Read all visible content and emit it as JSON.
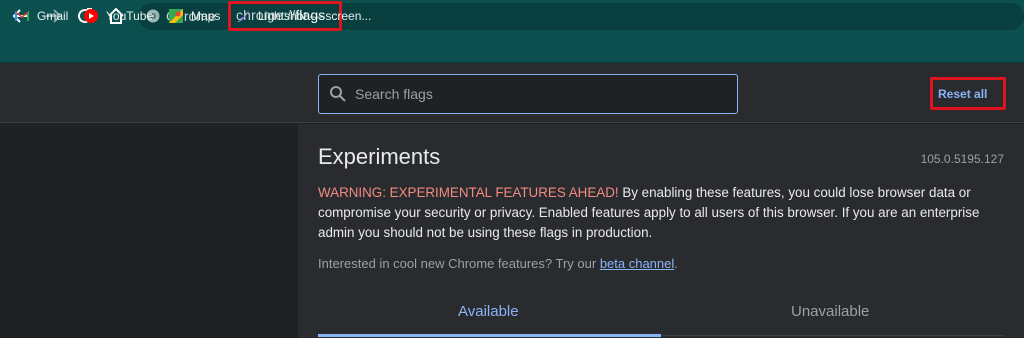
{
  "browser": {
    "site_chip_label": "Chrome",
    "url_scheme": "chrome://",
    "url_path": "flags",
    "highlight_color": "#e0141e"
  },
  "bookmarks": [
    {
      "label": "Gmail",
      "icon": "gmail-icon"
    },
    {
      "label": "YouTube",
      "icon": "youtube-icon"
    },
    {
      "label": "Maps",
      "icon": "maps-icon"
    },
    {
      "label": "Lightshot — screen...",
      "icon": "lightshot-icon"
    }
  ],
  "header": {
    "search_placeholder": "Search flags",
    "reset_label": "Reset all"
  },
  "main": {
    "title": "Experiments",
    "version": "105.0.5195.127",
    "warning_head": "WARNING: EXPERIMENTAL FEATURES AHEAD!",
    "warning_body": " By enabling these features, you could lose browser data or compromise your security or privacy. Enabled features apply to all users of this browser. If you are an enterprise admin you should not be using these flags in production.",
    "interested_text": "Interested in cool new Chrome features? Try our ",
    "beta_link": "beta channel",
    "interested_end": ".",
    "tabs": [
      {
        "label": "Available",
        "active": true
      },
      {
        "label": "Unavailable",
        "active": false
      }
    ]
  },
  "colors": {
    "toolbar": "#0b4f4f",
    "accent": "#8ab4f8",
    "warning": "#f28b82"
  }
}
